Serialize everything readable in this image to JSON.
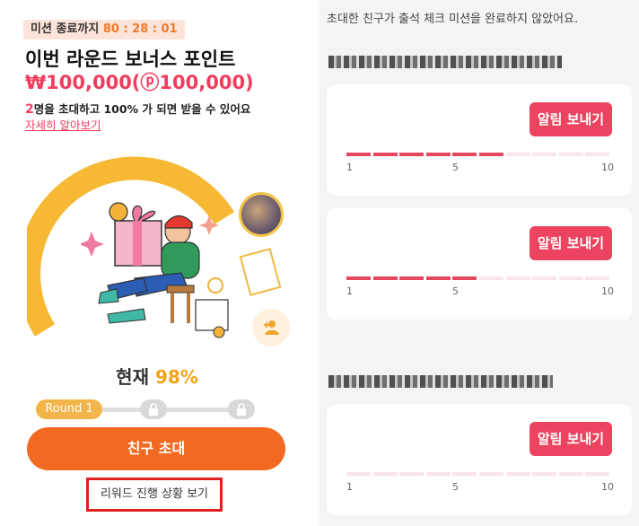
{
  "mission": {
    "timer_label": "미션 종료까지",
    "timer_value": "80 : 28 : 01",
    "title": "이번 라운드 보너스 포인트",
    "amount": "₩100,000(ⓟ100,000)",
    "desc_count": "2",
    "desc_text": "명을 초대하고 100% 가 되면 받을 수 있어요",
    "more_link": "자세히 알아보기",
    "progress_label": "현재",
    "progress_value": "98%",
    "round_label": "Round 1",
    "invite_button": "친구 초대",
    "reward_link": "리워드 진행 상황 보기"
  },
  "friends": {
    "notice": "초대한 친구가 출석 체크 미션을 완료하지 않았어요.",
    "notify_label": "알림 보내기",
    "ticks": [
      "1",
      "5",
      "10"
    ],
    "cards": [
      {
        "progress": 6
      },
      {
        "progress": 5
      },
      {
        "progress": 0
      }
    ]
  },
  "colors": {
    "accent_orange": "#f26a21",
    "accent_red": "#ef3d5e",
    "progress_yellow": "#f2a21b"
  },
  "icons": [
    "lock-icon",
    "add-user-icon",
    "gift-character-illustration"
  ]
}
